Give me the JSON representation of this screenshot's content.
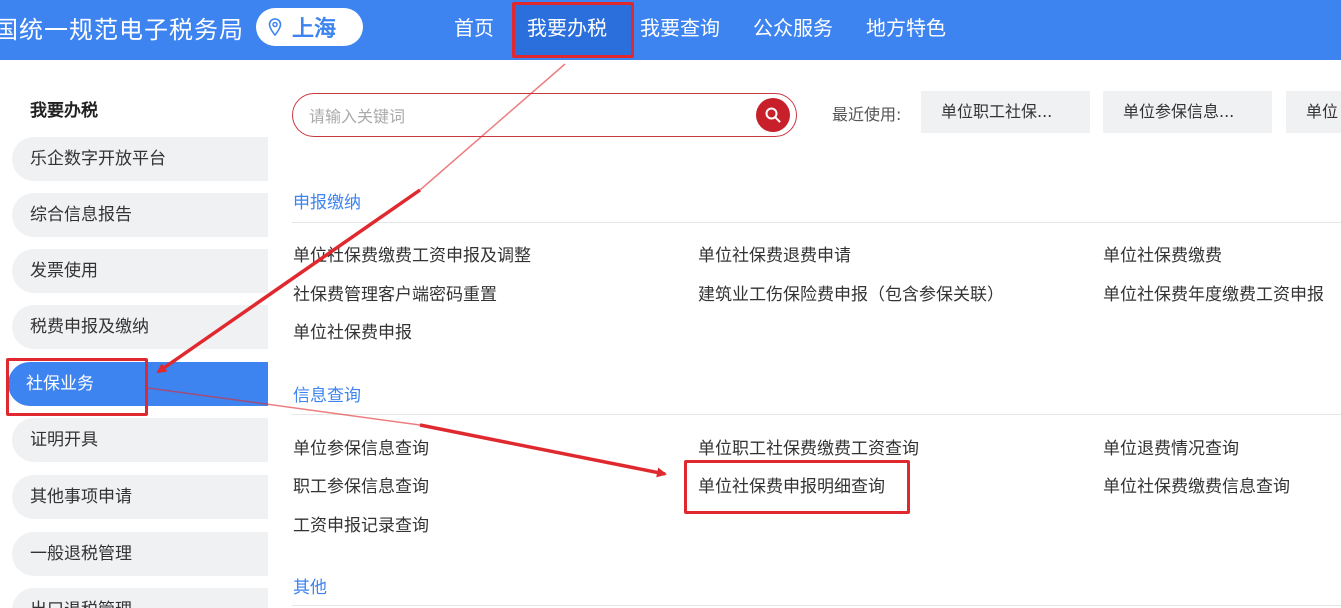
{
  "header": {
    "site_title": "国统一规范电子税务局",
    "location": "上海",
    "nav": [
      "首页",
      "我要办税",
      "我要查询",
      "公众服务",
      "地方特色"
    ],
    "active_nav": "我要办税",
    "colors": {
      "header_bg": "#3d84f0",
      "active_bg": "#2a6fdb"
    }
  },
  "sidebar": {
    "heading": "我要办税",
    "items": [
      "乐企数字开放平台",
      "综合信息报告",
      "发票使用",
      "税费申报及缴纳",
      "社保业务",
      "证明开具",
      "其他事项申请",
      "一般退税管理",
      "出口退税管理"
    ],
    "active_item": "社保业务"
  },
  "search": {
    "placeholder": "请输入关键词",
    "icon": "search-icon"
  },
  "recent": {
    "label": "最近使用:",
    "items": [
      "单位职工社保...",
      "单位参保信息...",
      "单位"
    ]
  },
  "sections": [
    {
      "title": "申报缴纳",
      "links": [
        "单位社保费缴费工资申报及调整",
        "单位社保费退费申请",
        "单位社保费缴费",
        "社保费管理客户端密码重置",
        "建筑业工伤保险费申报（包含参保关联）",
        "单位社保费年度缴费工资申报",
        "单位社保费申报"
      ]
    },
    {
      "title": "信息查询",
      "links": [
        "单位参保信息查询",
        "单位职工社保费缴费工资查询",
        "单位退费情况查询",
        "职工参保信息查询",
        "单位社保费申报明细查询",
        "单位社保费缴费信息查询",
        "工资申报记录查询"
      ]
    },
    {
      "title": "其他",
      "links": []
    }
  ],
  "annotation_color": "#e0292f"
}
